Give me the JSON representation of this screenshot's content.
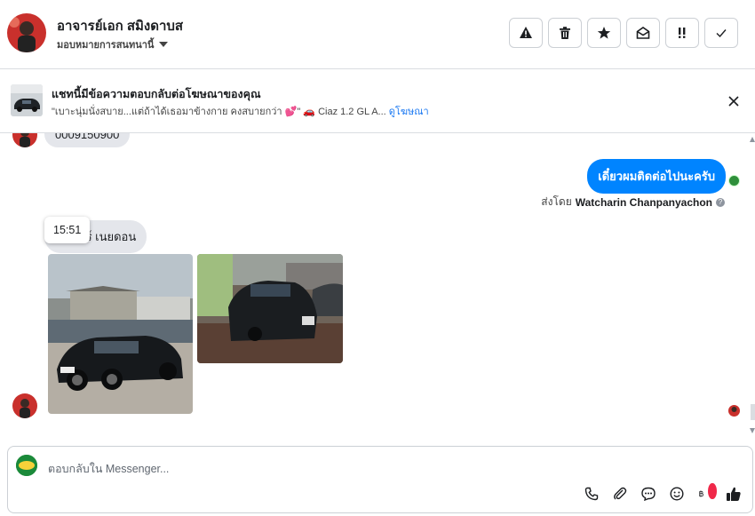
{
  "header": {
    "name": "อาจารย์เอก สมิงดาบส",
    "assign_label": "มอบหมายการสนทนานี้",
    "tools": [
      "warning-icon",
      "trash-icon",
      "star-icon",
      "mark-unread-icon",
      "follow-up-icon",
      "done-icon"
    ]
  },
  "ad": {
    "title": "แชทนี้มีข้อความตอบกลับต่อโฆษณาของคุณ",
    "desc": "\"เบาะนุ่มนั่งสบาย...แต่ถ้าได้เธอมาข้างกาย คงสบายกว่า 💕\" 🚗 Ciaz 1.2 GL A...",
    "link": "ดูโฆษณา"
  },
  "chat": {
    "partial_message": "0009150900",
    "outgoing_message": "เดี๋ยวผมติดต่อไปนะครับ",
    "sent_by_prefix": "ส่งโดย",
    "sent_by_name": "Watcharin Chanpanyachon",
    "incoming_message": "ทร์ เนยดอน",
    "tooltip_time": "15:51"
  },
  "composer": {
    "placeholder": "ตอบกลับใน Messenger...",
    "icons": [
      "phone-icon",
      "attach-icon",
      "chat-bubble-icon",
      "emoji-icon",
      "baht-icon",
      "thumbs-up-icon"
    ]
  },
  "colors": {
    "accent": "#0084ff",
    "link": "#1877f2",
    "incoming_bubble": "#e4e6eb"
  }
}
